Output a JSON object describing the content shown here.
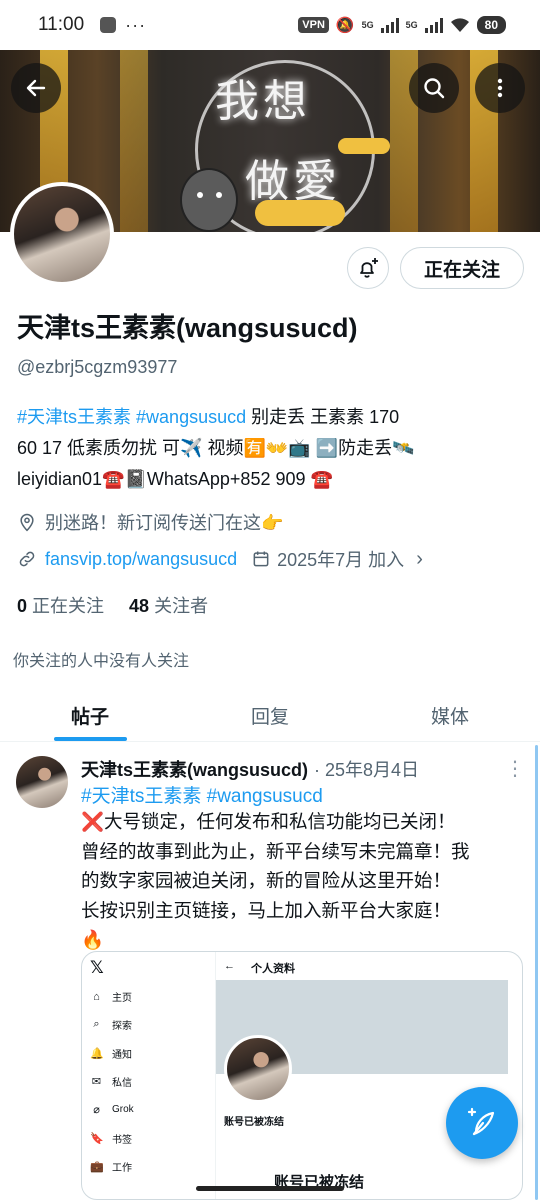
{
  "status_bar": {
    "time": "11:00",
    "vpn": "VPN",
    "sim1": "5G",
    "sim2": "5G",
    "battery": "80"
  },
  "header": {
    "back_icon": "arrow-left-icon",
    "search_icon": "search-icon",
    "more_icon": "more-vertical-icon",
    "banner_text_line1": "我想",
    "banner_text_line2": "做愛"
  },
  "profile": {
    "follow_button_label": "正在关注",
    "display_name": "天津ts王素素(wangsusucd)",
    "handle": "@ezbrj5cgzm93977",
    "bio": {
      "hashtag1": "#天津ts王素素",
      "hashtag2": "#wangsusucd",
      "line1_rest": " 别走丢 王素素 170",
      "line2": "60 17 低素质勿扰 可✈️ 视频🈶👐📺 ➡️防走丢🛰️",
      "line3": "leiyidian01☎️📓WhatsApp+852 909 ☎️"
    },
    "location": "别迷路！新订阅传送门在这👉",
    "website": "fansvip.top/wangsusucd",
    "joined": "2025年7月 加入",
    "following_count": "0",
    "following_label": "正在关注",
    "followers_count": "48",
    "followers_label": "关注者",
    "followers_note": "你关注的人中没有人关注"
  },
  "tabs": [
    {
      "label": "帖子",
      "active": true
    },
    {
      "label": "回复",
      "active": false
    },
    {
      "label": "媒体",
      "active": false
    }
  ],
  "post": {
    "author": "天津ts王素素(wangsusucd)",
    "date": "· 25年8月4日",
    "hashtags": "#天津ts王素素 #wangsusucd",
    "lines": [
      "❌大号锁定，任何发布和私信功能均已关闭！",
      "曾经的故事到此为止，新平台续写未完篇章！我",
      "的数字家园被迫关闭，新的冒险从这里开始！",
      "长按识别主页链接，马上加入新平台大家庭！",
      "🔥"
    ],
    "embed": {
      "logo": "𝕏",
      "back": "←",
      "title": "个人资料",
      "menu": [
        {
          "icon": "⌂",
          "label": "主页"
        },
        {
          "icon": "⌕",
          "label": "探索"
        },
        {
          "icon": "🔔",
          "label": "通知"
        },
        {
          "icon": "✉",
          "label": "私信"
        },
        {
          "icon": "⌀",
          "label": "Grok"
        },
        {
          "icon": "🔖",
          "label": "书签"
        },
        {
          "icon": "💼",
          "label": "工作"
        }
      ],
      "frozen_label": "账号已被冻结",
      "frozen_heading": "账号已被冻结"
    }
  },
  "fab_icon": "compose-post-icon",
  "colors": {
    "accent": "#1d9bf0",
    "text": "#0f1419",
    "secondary": "#536471"
  }
}
